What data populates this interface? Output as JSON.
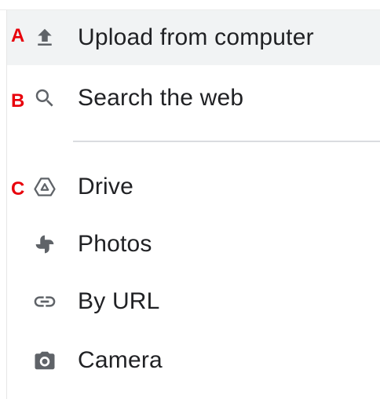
{
  "menu": {
    "items": [
      {
        "label": "Upload from computer",
        "icon": "upload-icon",
        "highlighted": true
      },
      {
        "label": "Search the web",
        "icon": "search-icon"
      },
      {
        "label": "Drive",
        "icon": "drive-icon"
      },
      {
        "label": "Photos",
        "icon": "photos-pinwheel-icon"
      },
      {
        "label": "By URL",
        "icon": "link-icon"
      },
      {
        "label": "Camera",
        "icon": "camera-icon"
      }
    ]
  },
  "annotations": {
    "markers": [
      "A",
      "B",
      "C"
    ],
    "marker_color": "#e8000b"
  },
  "colors": {
    "text": "#202124",
    "icon": "#5f6368",
    "highlight": "#f1f3f4",
    "divider": "#dadce0"
  }
}
